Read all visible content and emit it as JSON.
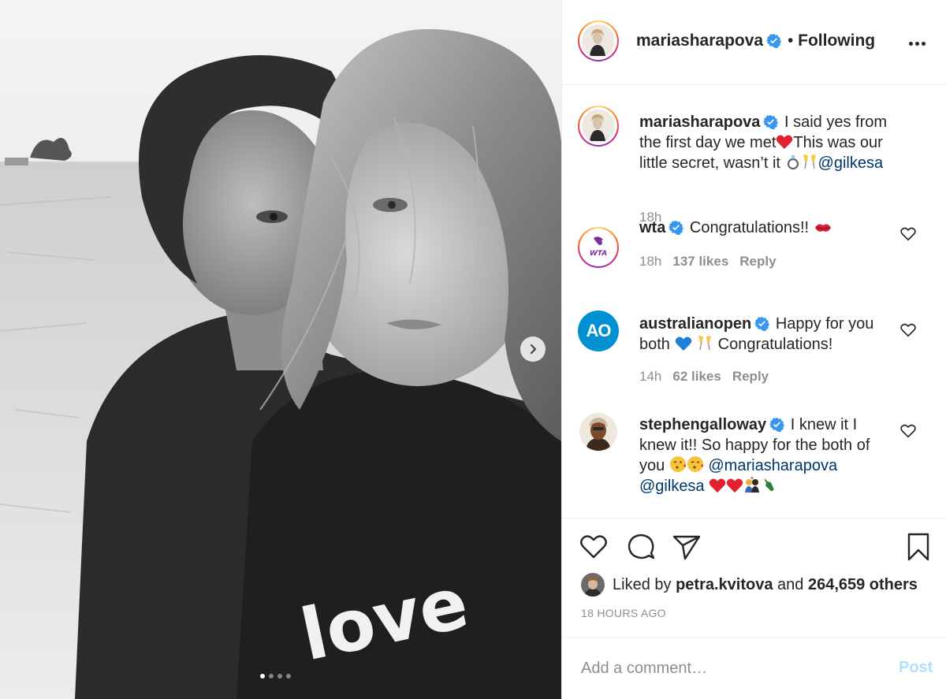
{
  "photo": {
    "shirt_text": "love",
    "carousel_count": 4,
    "carousel_active_index": 0,
    "next_icon": "chevron-right-icon"
  },
  "header": {
    "username": "mariasharapova",
    "separator": "•",
    "follow_status": "Following",
    "more_icon": "ellipsis-icon"
  },
  "caption": {
    "username": "mariasharapova",
    "text_1": "I said yes from the first day we met",
    "text_2": "This was our little secret, wasn’t it",
    "mention": "@gilkesa",
    "time": "18h"
  },
  "comments": [
    {
      "username": "wta",
      "avatar_text": "WTA",
      "text": "Congratulations!!",
      "time": "18h",
      "likes": "137 likes",
      "reply": "Reply"
    },
    {
      "username": "australianopen",
      "avatar_text": "AO",
      "text_1": "Happy for you both",
      "text_2": "Congratulations!",
      "time": "14h",
      "likes": "62 likes",
      "reply": "Reply"
    },
    {
      "username": "stephengalloway",
      "text_1": "I knew it I knew it!! So happy for the both of you",
      "mention_1": "@mariasharapova",
      "mention_2": "@gilkesa"
    }
  ],
  "actions": {
    "like_icon": "heart-icon",
    "comment_icon": "comment-bubble-icon",
    "share_icon": "paper-plane-icon",
    "save_icon": "bookmark-icon"
  },
  "likes": {
    "prefix": "Liked by",
    "liker": "petra.kvitova",
    "middle": "and",
    "others": "264,659 others"
  },
  "timestamp": "18 HOURS AGO",
  "comment_box": {
    "placeholder": "Add a comment…",
    "post_label": "Post"
  },
  "colors": {
    "verified": "#3897f0",
    "link": "#00376b",
    "muted": "#8e8e8e",
    "post_disabled": "#b2dffc",
    "heart_red": "#ed4956",
    "ao_blue": "#0091d2",
    "wta_purple": "#7b2fa0"
  }
}
